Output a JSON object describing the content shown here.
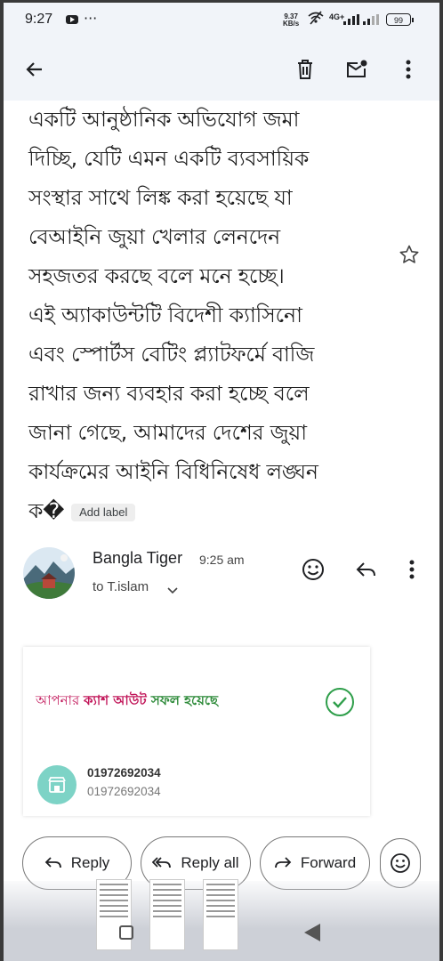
{
  "status_bar": {
    "time": "9:27",
    "more": "···",
    "speed_value": "9.37",
    "speed_unit": "KB/s",
    "network": "4G+",
    "battery": "99"
  },
  "toolbar": {
    "back_icon": "arrow-left-icon",
    "delete_icon": "trash-icon",
    "mark_unread_icon": "mail-unread-icon",
    "more_icon": "more-vert-icon"
  },
  "message_body": {
    "text": "একটি আনুষ্ঠানিক অভিযোগ জমা\nদিচ্ছি, যেটি এমন একটি ব্যবসায়িক\nসংস্থার সাথে লিঙ্ক করা হয়েছে যা\nবেআইনি জুয়া খেলার লেনদেন\nসহজতর করছে বলে মনে হচ্ছে।\nএই অ্যাকাউন্টটি বিদেশী ক্যাসিনো\nএবং স্পোর্টস বেটিং প্ল্যাটফর্মে বাজি\nরাখার জন্য ব্যবহার করা হচ্ছে বলে\nজানা গেছে, আমাদের দেশের জুয়া\nকার্যক্রমের আইনি বিধিনিষেধ লঙ্ঘন",
    "last_line": "ক�",
    "add_label": "Add label"
  },
  "message_header": {
    "sender": "Bangla Tiger",
    "time": "9:25 am",
    "recipient": "to T.islam"
  },
  "attachment_card": {
    "title_part1": "আপনার ",
    "title_part2": "ক্যাশ আউট",
    "title_part3": "  সফল হয়েছে",
    "number_primary": "01972692034",
    "number_secondary": "01972692034"
  },
  "actions": {
    "reply": "Reply",
    "reply_all": "Reply all",
    "forward": "Forward"
  }
}
